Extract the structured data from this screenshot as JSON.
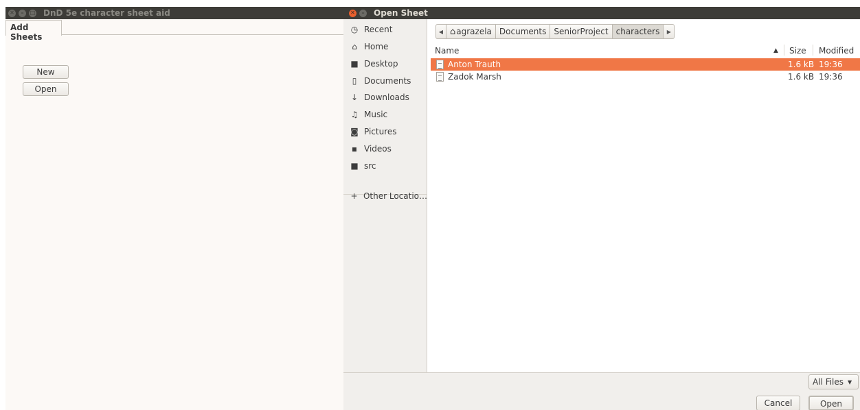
{
  "left_window": {
    "title": "DnD 5e character sheet aid",
    "tab_label": "Add Sheets",
    "new_label": "New",
    "open_label": "Open"
  },
  "dialog": {
    "title": "Open Sheet",
    "sidebar": [
      {
        "label": "Recent",
        "icon": "clock-icon"
      },
      {
        "label": "Home",
        "icon": "home-icon"
      },
      {
        "label": "Desktop",
        "icon": "folder-icon"
      },
      {
        "label": "Documents",
        "icon": "document-icon"
      },
      {
        "label": "Downloads",
        "icon": "download-icon"
      },
      {
        "label": "Music",
        "icon": "music-icon"
      },
      {
        "label": "Pictures",
        "icon": "camera-icon"
      },
      {
        "label": "Videos",
        "icon": "video-icon"
      },
      {
        "label": "src",
        "icon": "folder-icon"
      },
      {
        "label": "Other Locatio…",
        "icon": "plus-icon"
      }
    ],
    "path": [
      "agrazela",
      "Documents",
      "SeniorProject",
      "characters"
    ],
    "columns": {
      "name": "Name",
      "size": "Size",
      "modified": "Modified"
    },
    "files": [
      {
        "name": "Anton Trauth",
        "size": "1.6 kB",
        "modified": "19:36",
        "selected": true
      },
      {
        "name": "Zadok Marsh",
        "size": "1.6 kB",
        "modified": "19:36",
        "selected": false
      }
    ],
    "filter_label": "All Files",
    "cancel_label": "Cancel",
    "open_label": "Open"
  },
  "colors": {
    "titlebar": "#3d3c38",
    "selection": "#f07746",
    "close_button": "#e9602e",
    "window_bg": "#fcf9f6",
    "sidebar_bg": "#f1efec"
  }
}
